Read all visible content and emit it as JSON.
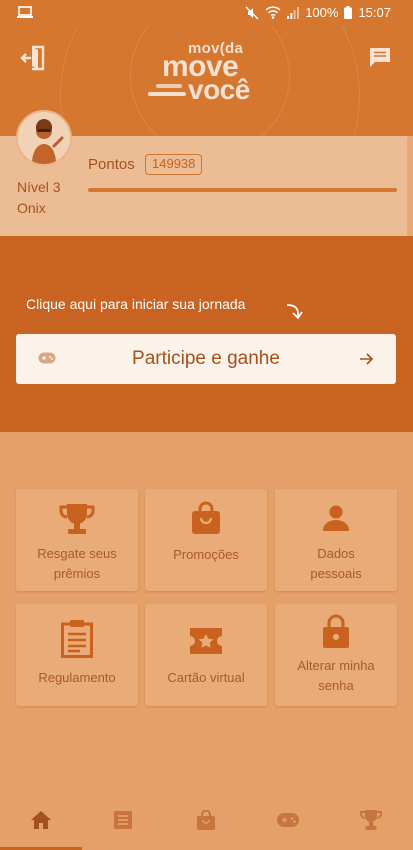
{
  "status_bar": {
    "battery": "100%",
    "time": "15:07"
  },
  "header": {
    "logo_top": "mov(da",
    "logo_middle": "move",
    "logo_bottom": "você"
  },
  "profile": {
    "level": "Nível 3",
    "tier": "Onix",
    "points_label": "Pontos",
    "points_value": "149938",
    "points_progress": 1.0
  },
  "journey": {
    "hint": "Clique aqui para iniciar sua jornada",
    "button_label": "Participe e ganhe"
  },
  "menu": {
    "tiles": [
      {
        "icon": "trophy-icon",
        "label_line1": "Resgate seus",
        "label_line2": "prêmios"
      },
      {
        "icon": "shopping-bag-icon",
        "label_line1": "Promoções",
        "label_line2": ""
      },
      {
        "icon": "person-icon",
        "label_line1": "Dados",
        "label_line2": "pessoais"
      },
      {
        "icon": "clipboard-icon",
        "label_line1": "Regulamento",
        "label_line2": ""
      },
      {
        "icon": "ticket-star-icon",
        "label_line1": "Cartão virtual",
        "label_line2": ""
      },
      {
        "icon": "padlock-icon",
        "label_line1": "Alterar minha",
        "label_line2": "senha"
      }
    ]
  },
  "bottom_nav": {
    "items": [
      "home-icon",
      "list-icon",
      "shopping-bag-icon",
      "gamepad-icon",
      "trophy-icon"
    ],
    "active": "home-icon"
  },
  "colors": {
    "accent": "#C96322",
    "header": "#D6772F",
    "background": "#E4A068",
    "text": "#A5511E"
  }
}
